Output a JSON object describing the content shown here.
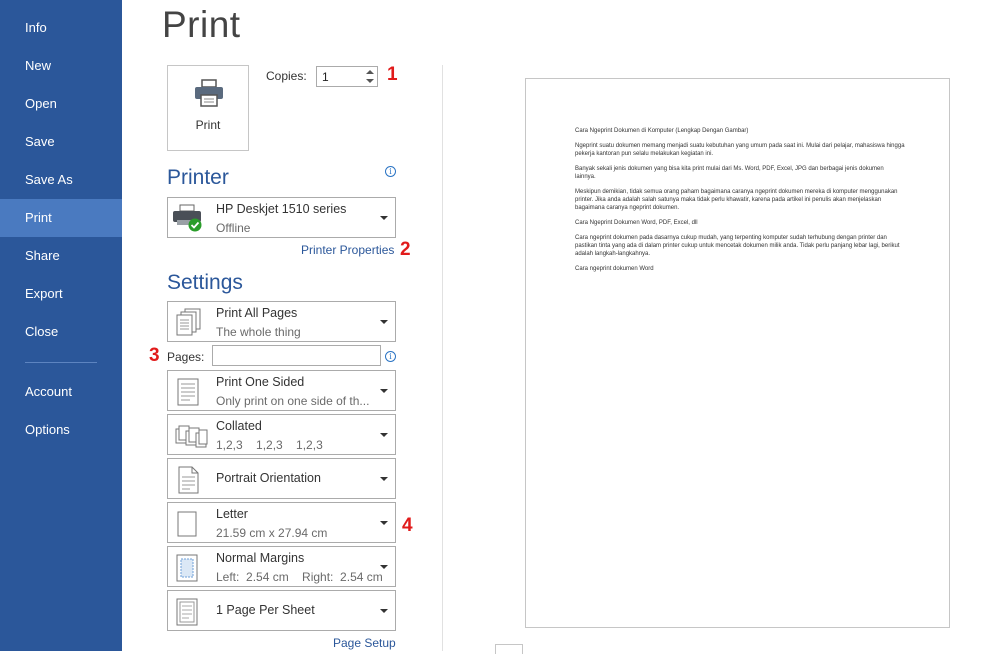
{
  "nav": {
    "items": [
      "Info",
      "New",
      "Open",
      "Save",
      "Save As",
      "Print",
      "Share",
      "Export",
      "Close"
    ],
    "bottom_items": [
      "Account",
      "Options"
    ],
    "active": "Print"
  },
  "page_title": "Print",
  "print_button": {
    "label": "Print",
    "icon": "printer-icon"
  },
  "copies": {
    "label": "Copies:",
    "value": "1"
  },
  "annotations": [
    "1",
    "2",
    "3",
    "4"
  ],
  "printer": {
    "section_title": "Printer",
    "name": "HP Deskjet 1510 series",
    "status": "Offline",
    "properties_link": "Printer Properties"
  },
  "settings": {
    "section_title": "Settings",
    "pages_label": "Pages:",
    "pages_value": "",
    "items": [
      {
        "title": "Print All Pages",
        "subtitle": "The whole thing",
        "icon": "all-pages-icon"
      },
      {
        "title": "Print One Sided",
        "subtitle": "Only print on one side of th...",
        "icon": "one-sided-icon"
      },
      {
        "title": "Collated",
        "subtitle": "1,2,3    1,2,3    1,2,3",
        "icon": "collated-icon"
      },
      {
        "title": "Portrait Orientation",
        "subtitle": "",
        "icon": "portrait-icon"
      },
      {
        "title": "Letter",
        "subtitle": "21.59 cm x 27.94 cm",
        "icon": "paper-size-icon"
      },
      {
        "title": "Normal Margins",
        "subtitle": "Left:  2.54 cm    Right:  2.54 cm",
        "icon": "margins-icon"
      },
      {
        "title": "1 Page Per Sheet",
        "subtitle": "",
        "icon": "pages-per-sheet-icon"
      }
    ],
    "page_setup_link": "Page Setup"
  },
  "preview": {
    "paragraphs": [
      "Cara Ngeprint Dokumen di Komputer (Lengkap Dengan Gambar)",
      "Ngeprint suatu dokumen memang menjadi suatu kebutuhan yang umum pada saat ini. Mulai dari pelajar, mahasiswa hingga pekerja kantoran pun selalu melakukan kegiatan ini.",
      "Banyak sekali jenis dokumen yang bisa kita print mulai dari Ms. Word, PDF, Excel, JPG dan berbagai jenis dokumen lainnya.",
      "Meskipun demikian, tidak semua orang paham bagaimana caranya ngeprint dokumen mereka di komputer menggunakan printer. Jika anda adalah salah satunya maka tidak perlu khawatir, karena pada artikel ini penulis akan menjelaskan bagaimana caranya ngeprint dokumen.",
      "Cara Ngeprint Dokumen Word, PDF, Excel, dll",
      "Cara ngeprint dokumen pada dasarnya cukup mudah, yang terpenting komputer sudah terhubung dengan printer dan pastikan tinta yang ada di dalam printer cukup untuk mencetak dokumen milik anda. Tidak perlu panjang lebar lagi, berikut adalah langkah-langkahnya.",
      "Cara ngeprint dokumen Word"
    ]
  },
  "colors": {
    "nav_bg": "#2b579a",
    "nav_active": "#4a7ac0",
    "accent": "#2b579a",
    "annotation": "#e11b1b"
  }
}
